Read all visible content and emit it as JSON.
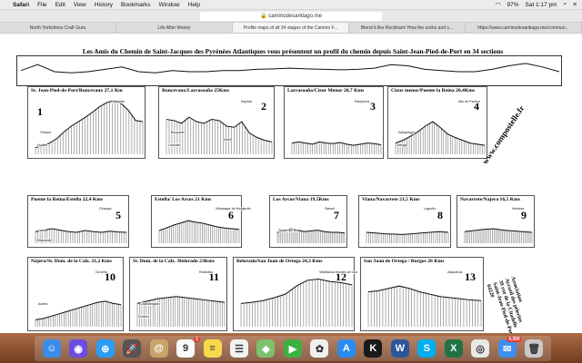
{
  "menubar": {
    "apple_icon": "apple-icon",
    "app_name": "Safari",
    "items": [
      "File",
      "Edit",
      "View",
      "History",
      "Bookmarks",
      "Window",
      "Help"
    ],
    "battery": "97%",
    "clock": "Sat 1:17 pm"
  },
  "toolbar": {
    "url": "caminodesantiago.me"
  },
  "tabs": [
    {
      "label": "North Yorkshires Craft Guru"
    },
    {
      "label": "Life After Money"
    },
    {
      "label": "Profile maps of all 34 stages of the Camino F..."
    },
    {
      "label": "Blend it like Reckham! How the socks and s..."
    },
    {
      "label": "https://www.caminodesantiago.me/commun..."
    }
  ],
  "page": {
    "title": "Les Amis du Chemin de Saint-Jacques des Pyrénées Atlantiques vous présentent un profil du chemin depuis Saint-Jean-Pied-de-Port en 34 sections",
    "site": "www.compostelle.fr",
    "association": [
      "Association",
      "Accueil des pèlerins",
      "39 rue de la Citadelle",
      "Saint-Jean-Pied-de-Port",
      "64220"
    ]
  },
  "panels": [
    {
      "title": "St. Jean-Pied-de-Port/Roncevaux 27,1 Km",
      "number": "1",
      "places": [
        "Lepoeder",
        "Orisson",
        "Huntto"
      ],
      "profile": [
        0.12,
        0.15,
        0.2,
        0.28,
        0.4,
        0.5,
        0.58,
        0.66,
        0.75,
        0.85,
        0.92,
        0.96,
        0.9,
        0.78,
        0.6,
        0.58
      ]
    },
    {
      "title": "Roncevaux/Larrasoaña 25Kms",
      "number": "2",
      "places": [
        "Espinal",
        "Burguete",
        "Linzoain",
        "Zubiri"
      ],
      "profile": [
        0.62,
        0.6,
        0.55,
        0.66,
        0.58,
        0.55,
        0.62,
        0.6,
        0.5,
        0.48,
        0.58,
        0.38,
        0.3,
        0.25,
        0.22
      ]
    },
    {
      "title": "Larrasoaña/Cizur Menor 20,7 Kms",
      "number": "3",
      "places": [
        "Pamplona"
      ],
      "profile": [
        0.2,
        0.22,
        0.2,
        0.18,
        0.22,
        0.2,
        0.19,
        0.21,
        0.18,
        0.16,
        0.18,
        0.2,
        0.19,
        0.17
      ]
    },
    {
      "title": "Cizur menor/Puente la Reina 20,4Kms",
      "number": "4",
      "places": [
        "Alto de Pardon",
        "Zariquiegui",
        "Uterga"
      ],
      "profile": [
        0.2,
        0.25,
        0.32,
        0.4,
        0.5,
        0.58,
        0.48,
        0.36,
        0.3,
        0.25,
        0.2,
        0.18,
        0.16
      ]
    },
    {
      "title": "Puente la Reina/Estella 22,4 Kms",
      "number": "5",
      "places": [
        "Cirauqui",
        "Lorca",
        "Villatuerta"
      ],
      "profile": [
        0.32,
        0.36,
        0.4,
        0.36,
        0.32,
        0.3,
        0.35,
        0.32,
        0.3,
        0.33,
        0.31,
        0.3
      ]
    },
    {
      "title": "Estella/ Los Arcos 21 Kms",
      "number": "6",
      "places": [
        "Villamayor de Monjardín"
      ],
      "profile": [
        0.35,
        0.42,
        0.5,
        0.56,
        0.62,
        0.58,
        0.55,
        0.5,
        0.45,
        0.42,
        0.4,
        0.38
      ]
    },
    {
      "title": "Los Arcos/Viana 19,5Kms",
      "number": "7",
      "places": [
        "Sansol",
        "Torres del Río"
      ],
      "profile": [
        0.3,
        0.34,
        0.4,
        0.36,
        0.32,
        0.34,
        0.36,
        0.32,
        0.3,
        0.3,
        0.28
      ]
    },
    {
      "title": "Viana/Navarrete 21,5 Kms",
      "number": "8",
      "places": [
        "Logroño"
      ],
      "profile": [
        0.3,
        0.28,
        0.26,
        0.25,
        0.24,
        0.26,
        0.28,
        0.3,
        0.32,
        0.3
      ]
    },
    {
      "title": "Navarrete/Najera 16,5 Kms",
      "number": "9",
      "places": [
        "Ventosa"
      ],
      "profile": [
        0.32,
        0.35,
        0.38,
        0.4,
        0.36,
        0.34,
        0.32,
        0.3
      ]
    },
    {
      "title": "Nájera/St. Dom. de la Calz. 21,2 Kms",
      "number": "10",
      "places": [
        "Cirueña",
        "Azofra"
      ],
      "profile": [
        0.12,
        0.14,
        0.18,
        0.22,
        0.26,
        0.3,
        0.34,
        0.38,
        0.42,
        0.44,
        0.4,
        0.38
      ]
    },
    {
      "title": "St. Dom. de la Calz. /Belorado 23Kms",
      "number": "11",
      "places": [
        "Redecilla",
        "Castildelgado",
        "Corbon"
      ],
      "profile": [
        0.4,
        0.44,
        0.48,
        0.5,
        0.52,
        0.5,
        0.48,
        0.46,
        0.44,
        0.42
      ]
    },
    {
      "title": "Belorado/San Juan de Ortega 24,3 Kms",
      "number": "12",
      "places": [
        "Villafranca Montes de Oca"
      ],
      "profile": [
        0.4,
        0.42,
        0.45,
        0.5,
        0.56,
        0.7,
        0.8,
        0.82,
        0.78,
        0.76,
        0.72
      ]
    },
    {
      "title": "San Juan de Ortega / Burgos 26 Kms",
      "number": "13",
      "places": [
        "Atapuerca"
      ],
      "profile": [
        0.6,
        0.62,
        0.66,
        0.7,
        0.66,
        0.6,
        0.56,
        0.52,
        0.5,
        0.48,
        0.46,
        0.45
      ]
    }
  ],
  "overview_profile": [
    0.55,
    0.8,
    0.5,
    0.45,
    0.5,
    0.6,
    0.7,
    0.5,
    0.45,
    0.55,
    0.5,
    0.5,
    0.55,
    0.55,
    0.6,
    0.62,
    0.65,
    0.62,
    0.6,
    0.58,
    0.6,
    0.65,
    0.8,
    0.75,
    0.6,
    0.55,
    0.5,
    0.5,
    0.6,
    0.75,
    0.85,
    0.7,
    0.5
  ],
  "dock": [
    {
      "name": "finder-icon",
      "color": "#3b8be8",
      "glyph": "☺"
    },
    {
      "name": "siri-icon",
      "color": "#6a4de0",
      "glyph": "◉"
    },
    {
      "name": "safari-icon",
      "color": "#2a9df4",
      "glyph": "⊕"
    },
    {
      "name": "launchpad-icon",
      "color": "#555",
      "glyph": "🚀"
    },
    {
      "name": "contacts-icon",
      "color": "#c9a46b",
      "glyph": "@"
    },
    {
      "name": "calendar-icon",
      "color": "#fafafa",
      "glyph": "9",
      "badge": "1"
    },
    {
      "name": "notes-icon",
      "color": "#f7d94c",
      "glyph": "≡"
    },
    {
      "name": "reminders-icon",
      "color": "#f2f2f2",
      "glyph": "☰"
    },
    {
      "name": "maps-icon",
      "color": "#7cc16b",
      "glyph": "◆"
    },
    {
      "name": "facetime-icon",
      "color": "#3cb043",
      "glyph": "▶"
    },
    {
      "name": "photos-icon",
      "color": "#f0f0f0",
      "glyph": "✿"
    },
    {
      "name": "app-store-icon",
      "color": "#2a8cf0",
      "glyph": "A"
    },
    {
      "name": "kindle-icon",
      "color": "#1a1a1a",
      "glyph": "K"
    },
    {
      "name": "word-icon",
      "color": "#2b579a",
      "glyph": "W"
    },
    {
      "name": "skype-icon",
      "color": "#00aff0",
      "glyph": "S"
    },
    {
      "name": "excel-icon",
      "color": "#217346",
      "glyph": "X"
    },
    {
      "name": "chrome-icon",
      "color": "#e8e8e8",
      "glyph": "◎"
    },
    {
      "name": "mail-icon",
      "color": "#3d8ff0",
      "glyph": "✉",
      "badge": "4,350"
    },
    {
      "name": "trash-icon",
      "color": "#c8c8c8",
      "glyph": "🗑"
    }
  ]
}
